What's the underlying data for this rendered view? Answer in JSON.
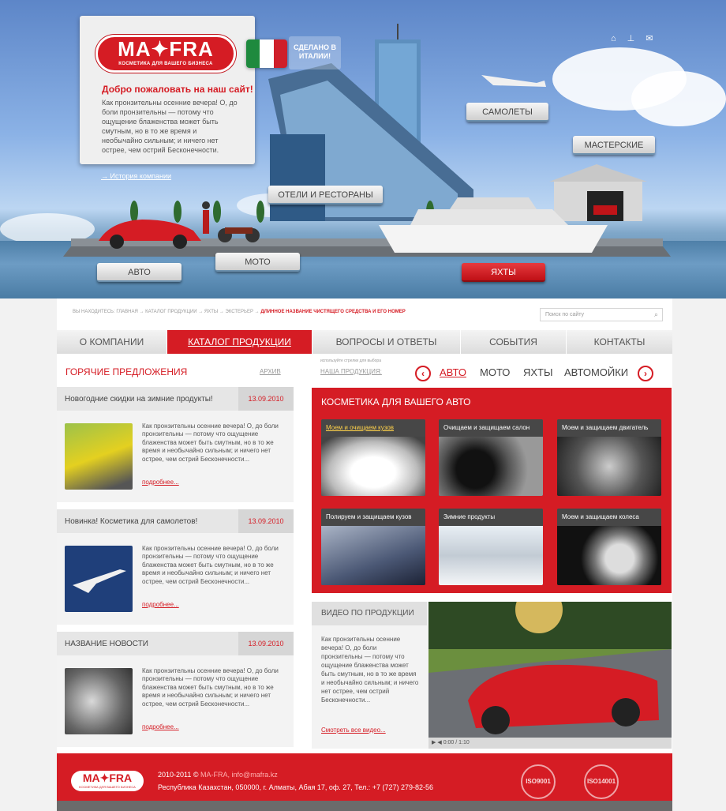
{
  "hero": {
    "logo_text": "MA✦FRA",
    "logo_sub": "КОСМЕТИКА ДЛЯ ВАШЕГО БИЗНЕСА",
    "made_in": "СДЕЛАНО В ИТАЛИИ!",
    "welcome_title": "Добро пожаловать на наш сайт!",
    "welcome_text": "Как пронзительны осенние вечера! О, до боли пронзительны — потому что ощущение блаженства может быть смутным, но в то же время и необычайно сильным; и ничего нет острее, чем острий Бесконечности.",
    "history_link": "→ История компании",
    "top_icons": [
      "home-icon",
      "sitemap-icon",
      "mail-icon"
    ],
    "buttons": {
      "auto": "АВТО",
      "moto": "МОТО",
      "hotels": "ОТЕЛИ И РЕСТОРАНЫ",
      "planes": "САМОЛЕТЫ",
      "workshops": "МАСТЕРСКИЕ",
      "yachts": "ЯХТЫ"
    }
  },
  "breadcrumb": {
    "prefix": "ВЫ НАХОДИТЕСЬ:",
    "path": "ГЛАВНАЯ → КАТАЛОГ ПРОДУКЦИИ → ЯХТЫ → ЭКСТЕРЬЕР →",
    "current": "ДЛИННОЕ НАЗВАНИЕ ЧИСТЯЩЕГО СРЕДСТВА И ЕГО НОМЕР"
  },
  "search": {
    "placeholder": "Поиск по сайту"
  },
  "menu": [
    "О КОМПАНИИ",
    "КАТАЛОГ ПРОДУКЦИИ",
    "ВОПРОСЫ И ОТВЕТЫ",
    "СОБЫТИЯ",
    "КОНТАКТЫ"
  ],
  "hot": {
    "title": "ГОРЯЧИЕ ПРЕДЛОЖЕНИЯ",
    "archive": "АРХИВ",
    "more_label": "подробнее...",
    "news": [
      {
        "title": "Новогодние скидки на зимние продукты!",
        "date": "13.09.2010",
        "text": "Как пронзительны осенние вечера! О, до боли пронзительны — потому что ощущение блаженства может быть смутным, но в то же время и необычайно сильным; и ничего нет острее, чем острий Бесконечности..."
      },
      {
        "title": "Новинка! Косметика для самолетов!",
        "date": "13.09.2010",
        "text": "Как пронзительны осенние вечера! О, до боли пронзительны — потому что ощущение блаженства может быть смутным, но в то же время и необычайно сильным; и ничего нет острее, чем острий Бесконечности..."
      },
      {
        "title": "НАЗВАНИЕ НОВОСТИ",
        "date": "13.09.2010",
        "text": "Как пронзительны осенние вечера! О, до боли пронзительны — потому что ощущение блаженства может быть смутным, но в то же время и необычайно сильным; и ничего нет острее, чем острий Бесконечности..."
      }
    ]
  },
  "products": {
    "small_label": "используйте стрелки для выбора",
    "heading": "НАША ПРОДУКЦИЯ:",
    "categories": [
      "АВТО",
      "МОТО",
      "ЯХТЫ",
      "АВТОМОЙКИ"
    ],
    "box_title": "КОСМЕТИКА ДЛЯ ВАШЕГО АВТО",
    "tiles": [
      "Моем и очищаем кузов",
      "Очищаем и защищаем салон",
      "Моем и защищаем двигатель",
      "Полируем и защищаем кузов",
      "Зимние продукты",
      "Моем и защищаем колеса"
    ]
  },
  "video": {
    "title": "ВИДЕО ПО ПРОДУКЦИИ",
    "text": "Как пронзительны осенние вечера! О, до боли пронзительны — потому что ощущение блаженства может быть смутным, но в то же время и необычайно сильным; и ничего нет острее, чем острий Бесконечности...",
    "link": "Смотреть все видео...",
    "time": "0:00 / 1:10"
  },
  "footer": {
    "logo_text": "MA✦FRA",
    "logo_sub": "КОСМЕТИКА ДЛЯ ВАШЕГО БИЗНЕСА",
    "copyright": "2010-2011 ©",
    "company": "MA-FRA,",
    "email": "info@mafra.kz",
    "address": "Республика Казахстан, 050000, г. Алматы, Абая 17, оф. 27, Тел.: +7 (727) 279-82-56",
    "iso1": "ISO9001",
    "iso2": "ISO14001"
  }
}
